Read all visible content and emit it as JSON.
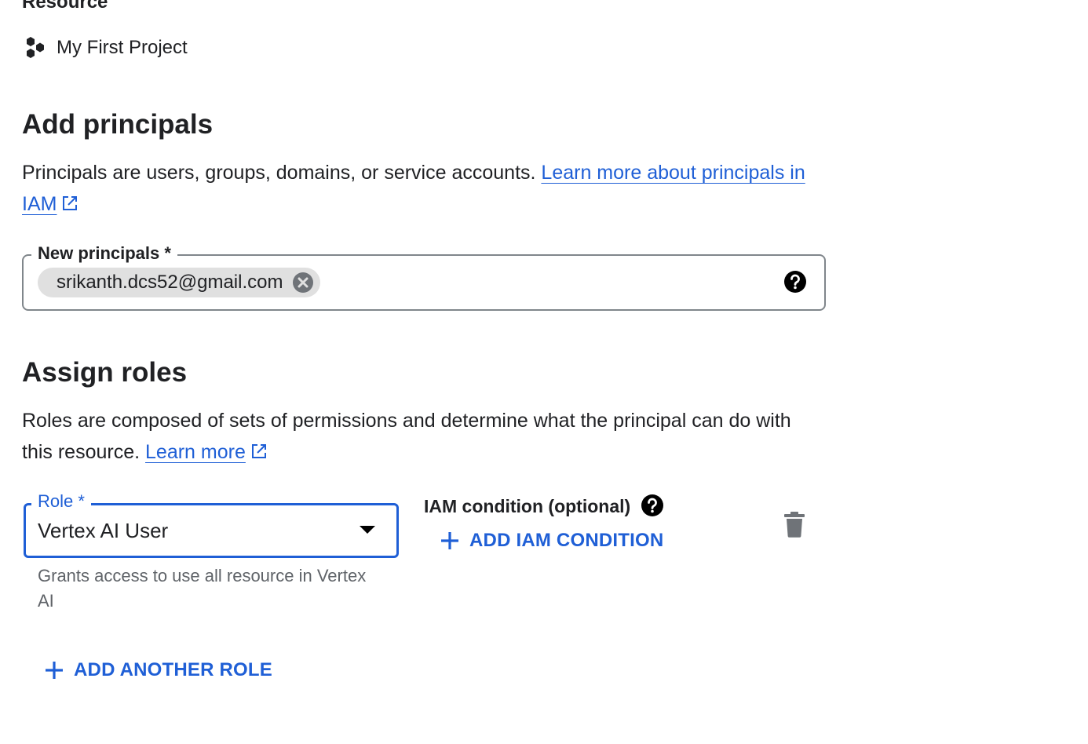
{
  "resource": {
    "heading": "Resource",
    "project_name": "My First Project",
    "project_icon": "project-hexagons-icon"
  },
  "add_principals": {
    "title": "Add principals",
    "description": "Principals are users, groups, domains, or service accounts.",
    "learn_more_link": "Learn more about principals in IAM",
    "field_label": "New principals *",
    "chips": [
      "srikanth.dcs52@gmail.com"
    ],
    "help_icon": "help-circle-icon"
  },
  "assign_roles": {
    "title": "Assign roles",
    "description": "Roles are composed of sets of permissions and determine what the principal can do with this resource.",
    "learn_more_link": "Learn more",
    "role_label": "Role *",
    "role_value": "Vertex AI User",
    "role_helper": "Grants access to use all resource in Vertex AI",
    "iam_condition_label": "IAM condition (optional)",
    "add_iam_condition": "ADD IAM CONDITION",
    "add_another_role": "ADD ANOTHER ROLE"
  },
  "colors": {
    "accent": "#1f5fd6",
    "text": "#202124",
    "secondary_text": "#5f6368",
    "chip_bg": "#e0e0e0",
    "border": "#80868b"
  }
}
